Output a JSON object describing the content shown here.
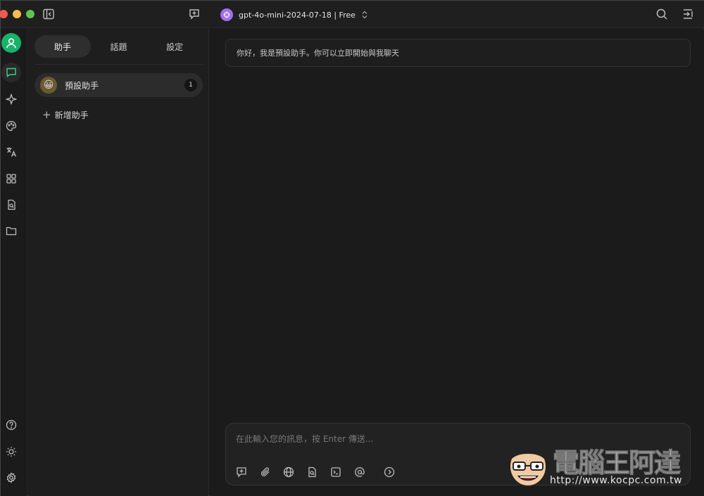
{
  "titlebar": {
    "model_name": "gpt-4o-mini-2024-07-18 | Free"
  },
  "sidebar": {
    "tabs": [
      {
        "label": "助手",
        "active": true
      },
      {
        "label": "話題",
        "active": false
      },
      {
        "label": "設定",
        "active": false
      }
    ],
    "assistant": {
      "emoji": "😀",
      "name": "預設助手",
      "count": "1"
    },
    "add_label": "新增助手"
  },
  "main": {
    "greeting": "你好，我是預設助手。你可以立即開始與我聊天",
    "composer_placeholder": "在此輸入您的訊息，按 Enter 傳送..."
  },
  "watermark": {
    "title": "電腦王阿達",
    "url": "http://www.kocpc.com.tw"
  },
  "colors": {
    "accent_green": "#19b26b",
    "model_purple": "#a26ff0"
  }
}
